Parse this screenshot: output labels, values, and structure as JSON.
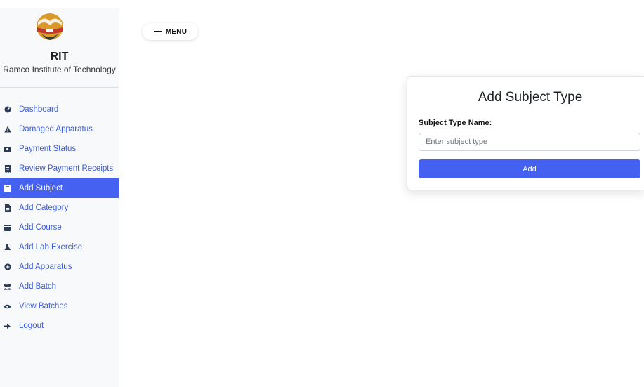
{
  "brand": {
    "short_name": "RIT",
    "full_name": "Ramco Institute of Technology",
    "logo": "rit-logo"
  },
  "colors": {
    "accent": "#4461f2",
    "link": "#3b5bdb",
    "sidebar_bg": "#f8f9fa"
  },
  "sidebar": {
    "items": [
      {
        "label": "Dashboard",
        "icon": "dashboard-icon",
        "active": false
      },
      {
        "label": "Damaged Apparatus",
        "icon": "warning-icon",
        "active": false
      },
      {
        "label": "Payment Status",
        "icon": "money-icon",
        "active": false
      },
      {
        "label": "Review Payment Receipts",
        "icon": "receipt-icon",
        "active": false
      },
      {
        "label": "Add Subject",
        "icon": "book-icon",
        "active": true
      },
      {
        "label": "Add Category",
        "icon": "file-icon",
        "active": false
      },
      {
        "label": "Add Course",
        "icon": "calendar-icon",
        "active": false
      },
      {
        "label": "Add Lab Exercise",
        "icon": "flask-icon",
        "active": false
      },
      {
        "label": "Add Apparatus",
        "icon": "plus-circle-icon",
        "active": false
      },
      {
        "label": "Add Batch",
        "icon": "users-icon",
        "active": false
      },
      {
        "label": "View Batches",
        "icon": "eye-icon",
        "active": false
      },
      {
        "label": "Logout",
        "icon": "logout-icon",
        "active": false
      }
    ]
  },
  "header": {
    "menu_label": "MENU"
  },
  "form": {
    "title": "Add Subject Type",
    "field_label": "Subject Type Name:",
    "placeholder": "Enter subject type",
    "value": "",
    "submit_label": "Add"
  }
}
